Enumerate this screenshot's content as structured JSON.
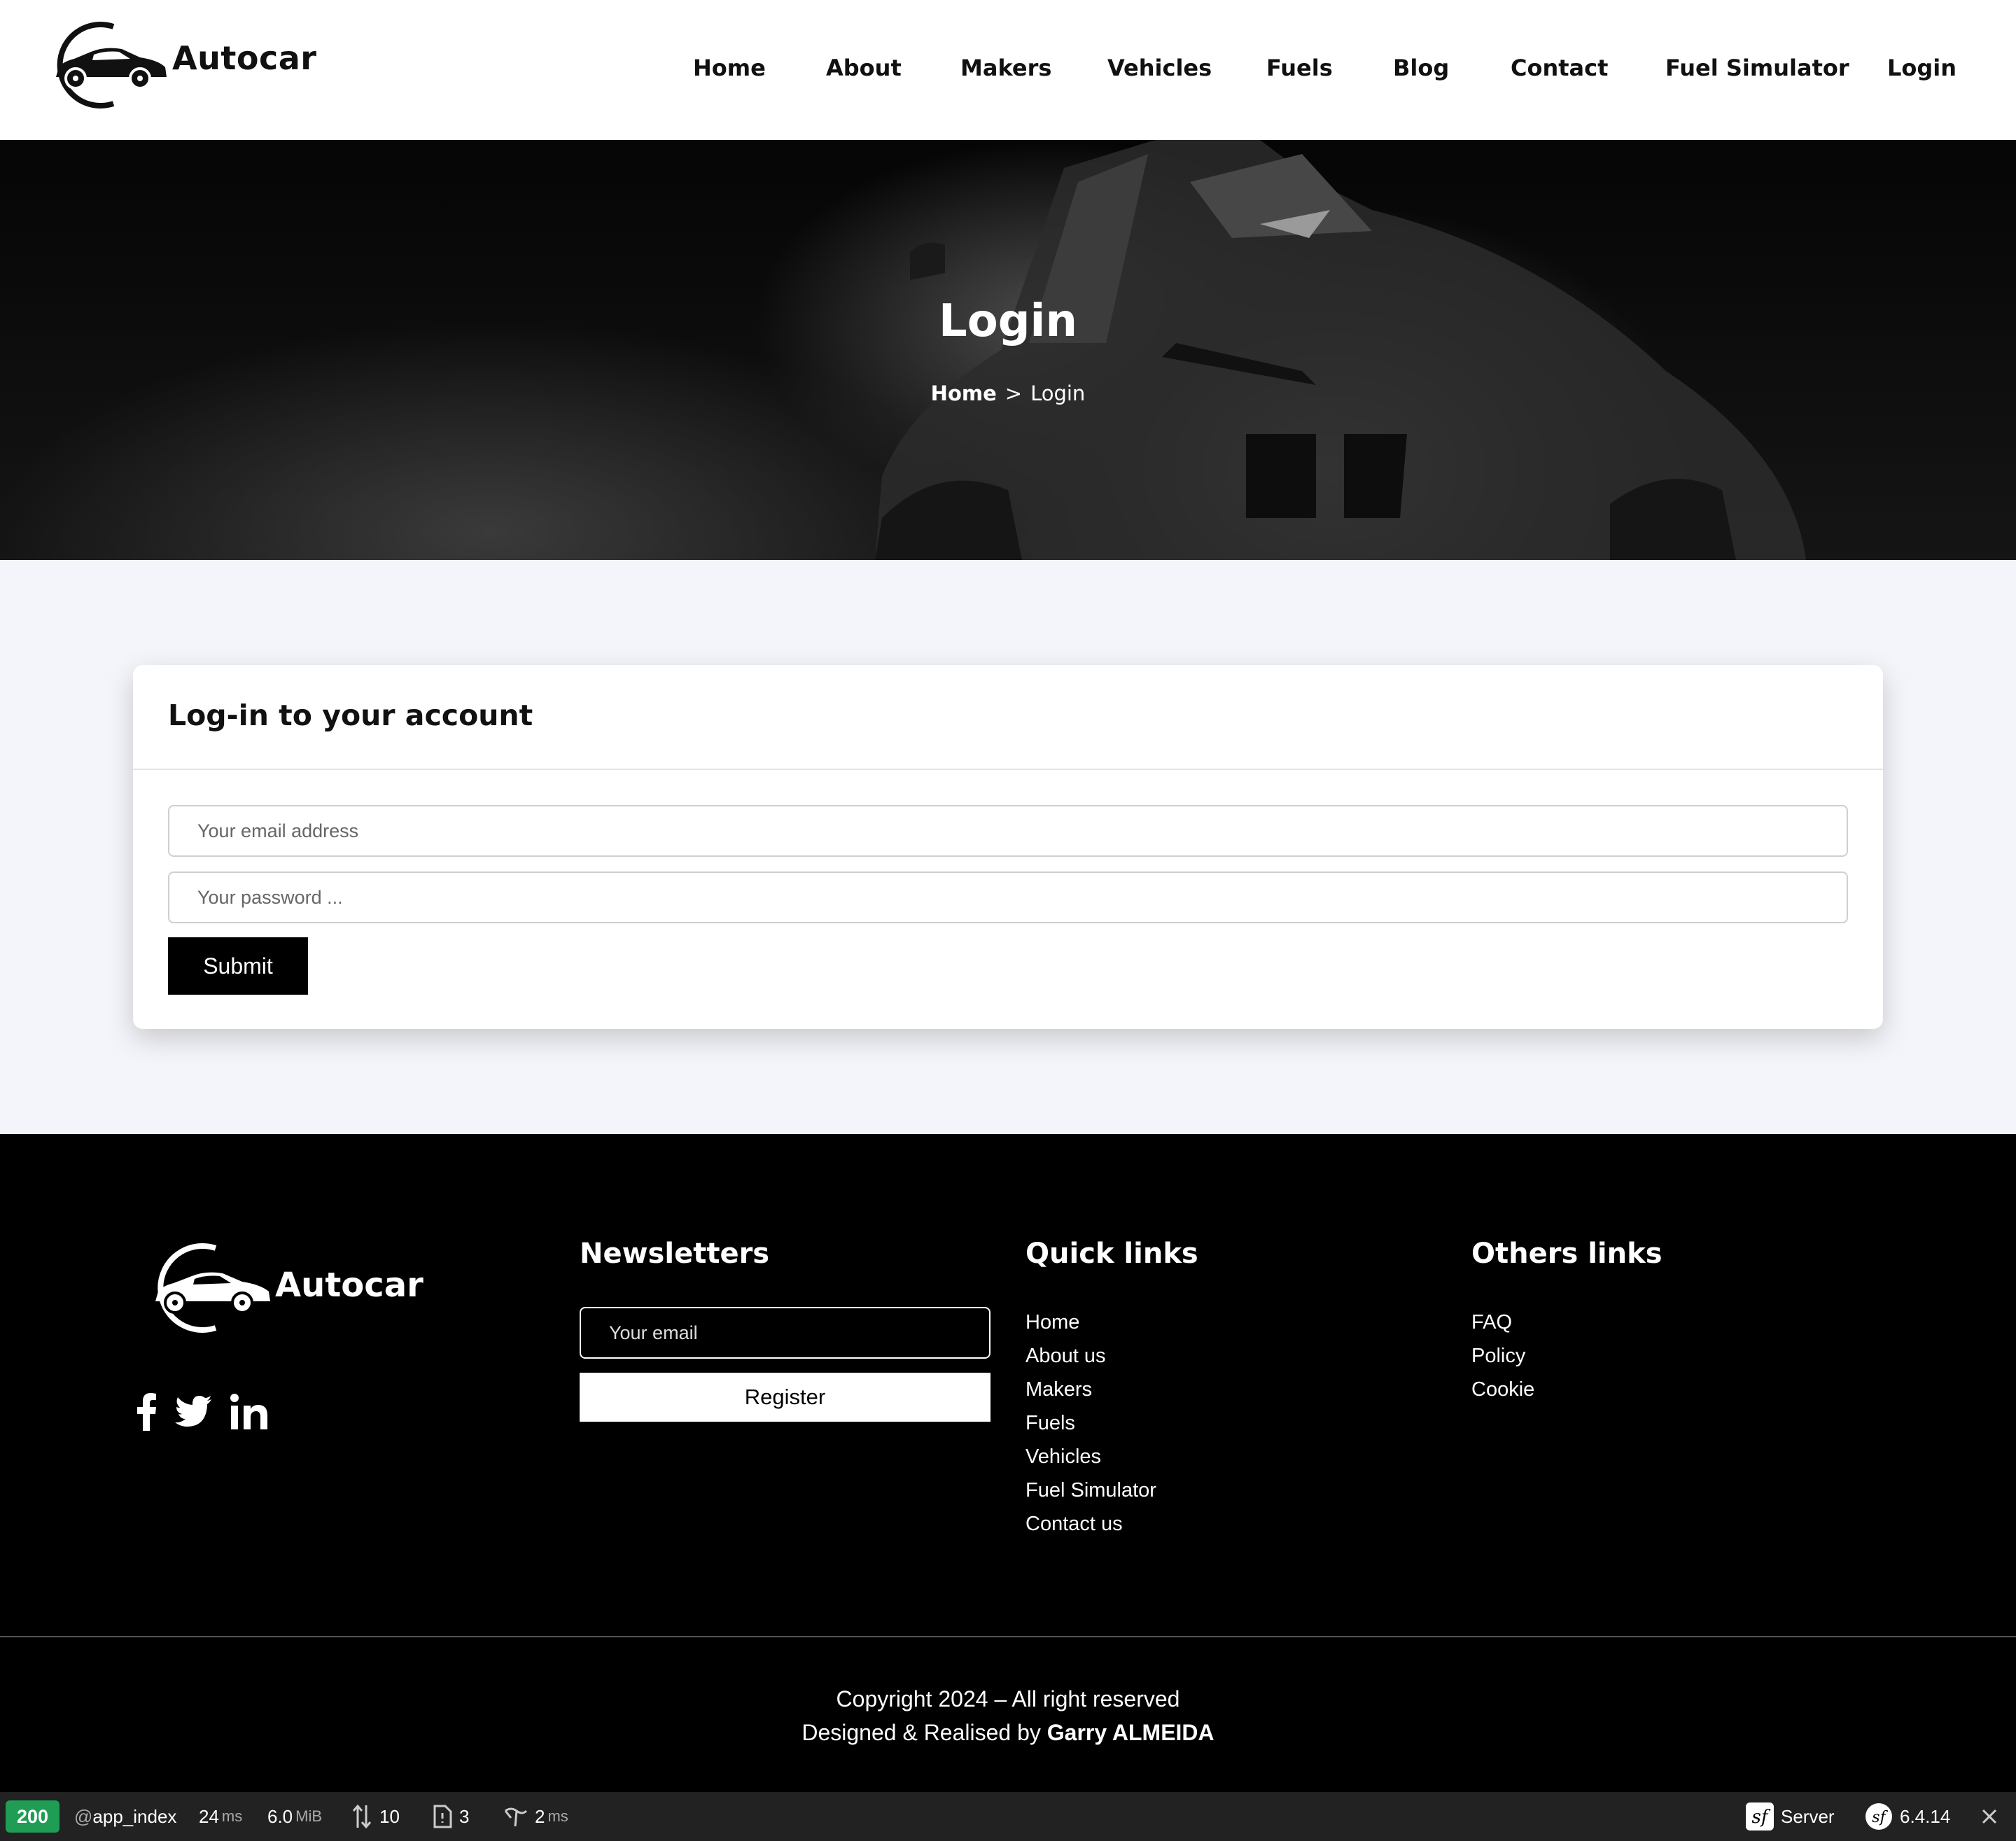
{
  "header": {
    "logo_text": "Autocar",
    "nav": [
      "Home",
      "About",
      "Makers",
      "Vehicles",
      "Fuels",
      "Blog",
      "Contact",
      "Fuel Simulator",
      "Login"
    ]
  },
  "hero": {
    "title": "Login",
    "breadcrumb_home": "Home",
    "breadcrumb_separator": ">",
    "breadcrumb_current": "Login"
  },
  "login": {
    "title": "Log-in to your account",
    "email_placeholder": "Your email address",
    "password_placeholder": "Your password ...",
    "submit_label": "Submit"
  },
  "footer": {
    "logo_text": "Autocar",
    "social_icons": [
      "facebook-icon",
      "twitter-icon",
      "linkedin-icon"
    ],
    "newsletter": {
      "title": "Newsletters",
      "email_placeholder": "Your email",
      "register_label": "Register"
    },
    "quick_links": {
      "title": "Quick links",
      "items": [
        "Home",
        "About us",
        "Makers",
        "Fuels",
        "Vehicles",
        "Fuel Simulator",
        "Contact us"
      ]
    },
    "other_links": {
      "title": "Others links",
      "items": [
        "FAQ",
        "Policy",
        "Cookie"
      ]
    },
    "copyright": "Copyright 2024 – All right reserved",
    "credit_prefix": "Designed & Realised by",
    "credit_name": "Garry ALMEIDA"
  },
  "toolbar": {
    "status": "200",
    "route": "@app_index",
    "time_value": "24",
    "time_unit": "ms",
    "memory_value": "6.0",
    "memory_unit": "MiB",
    "requests": "10",
    "files": "3",
    "events_value": "2",
    "events_unit": "ms",
    "server_label": "Server",
    "version": "6.4.14",
    "status_color": "#1f9d55"
  }
}
